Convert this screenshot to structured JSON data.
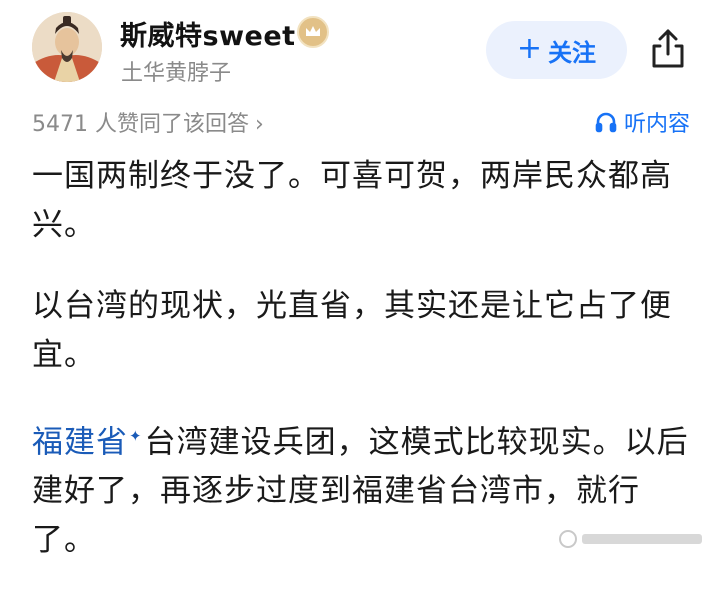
{
  "header": {
    "author_name": "斯威特sweet",
    "author_subtitle": "土华黄脖子",
    "follow_label": "关注",
    "follow_plus": "+"
  },
  "meta": {
    "upvote_text": "5471 人赞同了该回答",
    "upvote_chevron": "›",
    "listen_label": "听内容"
  },
  "answer": {
    "paragraphs": [
      "一国两制终于没了。可喜可贺，两岸民众都高兴。",
      "以台湾的现状，光直省，其实还是让它占了便宜。"
    ],
    "para3_link": "福建省",
    "para3_rest": "台湾建设兵团，这模式比较现实。以后建好了，再逐步过度到福建省台湾市，就行了。"
  },
  "icons": {
    "badge": "crown-badge-icon",
    "share": "share-icon",
    "headphones": "headphones-icon",
    "link_spark": "sparkle-icon"
  },
  "colors": {
    "accent": "#1772f6",
    "link": "#1a5bb8",
    "muted": "#8a8a8a",
    "follow_bg": "#ebf1fd"
  }
}
